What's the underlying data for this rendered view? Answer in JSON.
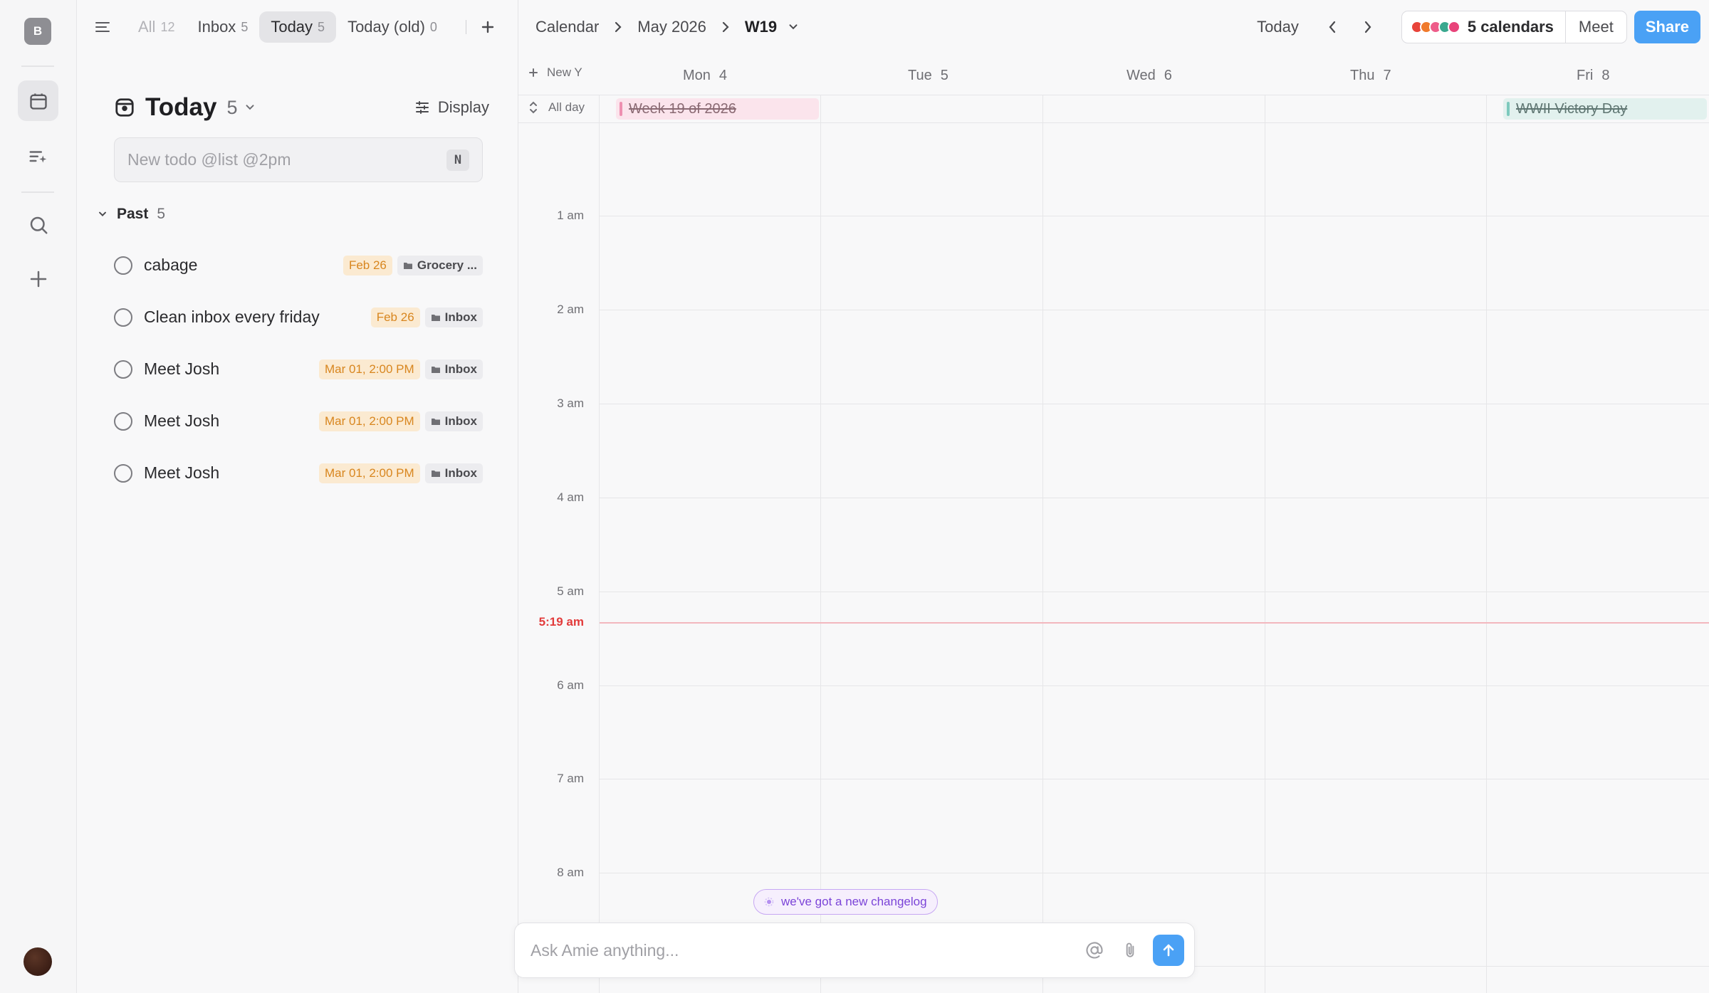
{
  "rail": {
    "workspace_initial": "B"
  },
  "tabs": [
    {
      "label": "All",
      "count": "12",
      "state": "faded"
    },
    {
      "label": "Inbox",
      "count": "5",
      "state": ""
    },
    {
      "label": "Today",
      "count": "5",
      "state": "active"
    },
    {
      "label": "Today (old)",
      "count": "0",
      "state": ""
    }
  ],
  "todo": {
    "title": "Today",
    "count": "5",
    "display_label": "Display",
    "input_placeholder": "New todo @list @2pm",
    "input_shortcut": "N",
    "section": {
      "label": "Past",
      "count": "5"
    },
    "items": [
      {
        "text": "cabage",
        "date": "Feb 26",
        "list": "Grocery ..."
      },
      {
        "text": "Clean inbox every friday",
        "date": "Feb 26",
        "list": "Inbox"
      },
      {
        "text": "Meet Josh",
        "date": "Mar 01, 2:00 PM",
        "list": "Inbox"
      },
      {
        "text": "Meet Josh",
        "date": "Mar 01, 2:00 PM",
        "list": "Inbox"
      },
      {
        "text": "Meet Josh",
        "date": "Mar 01, 2:00 PM",
        "list": "Inbox"
      }
    ]
  },
  "calendar": {
    "breadcrumb": [
      "Calendar",
      "May 2026",
      "W19"
    ],
    "today_label": "Today",
    "calendars_label": "5 calendars",
    "calendar_colors": [
      "#e8443a",
      "#f07a2c",
      "#ee5d8a",
      "#3aa88f",
      "#e8437a"
    ],
    "meet_label": "Meet",
    "share_label": "Share",
    "new_label": "New Y",
    "allday_label": "All day",
    "days": [
      {
        "name": "Mon",
        "num": "4"
      },
      {
        "name": "Tue",
        "num": "5"
      },
      {
        "name": "Wed",
        "num": "6"
      },
      {
        "name": "Thu",
        "num": "7"
      },
      {
        "name": "Fri",
        "num": "8"
      }
    ],
    "allday_events": [
      {
        "title": "Week 19 of 2026",
        "day": "Mon",
        "color": "pink"
      },
      {
        "title": "WWII Victory Day",
        "day": "Fri",
        "color": "teal"
      }
    ],
    "hours": [
      "1 am",
      "2 am",
      "3 am",
      "4 am",
      "5 am",
      "6 am",
      "7 am",
      "8 am"
    ],
    "now_label": "5:19 am",
    "changelog_label": "we've got a new changelog",
    "ask_placeholder": "Ask Amie anything..."
  }
}
